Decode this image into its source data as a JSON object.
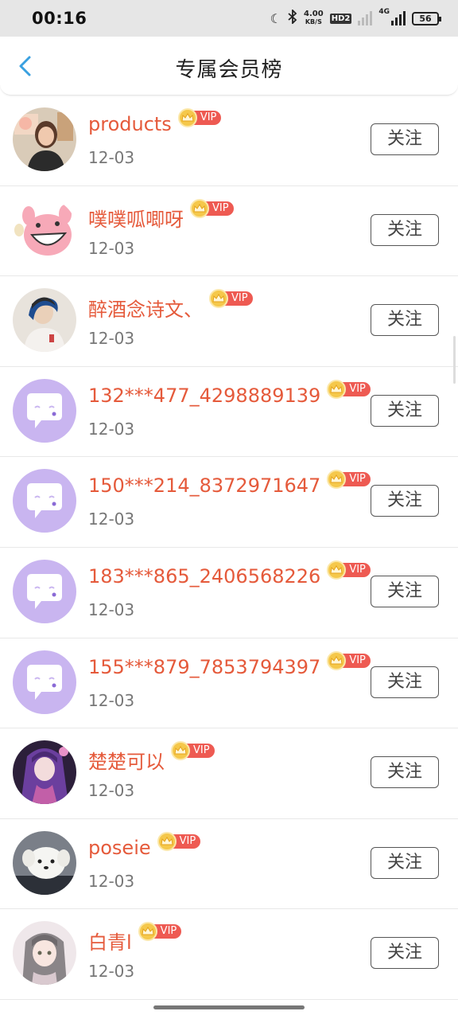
{
  "status_bar": {
    "time": "00:16",
    "speed_value": "4.00",
    "speed_unit": "KB/S",
    "hd_label": "HD2",
    "network": "4G",
    "battery": "56"
  },
  "header": {
    "title": "专属会员榜"
  },
  "members": [
    {
      "name": "products",
      "vip": "VIP",
      "date": "12-03",
      "follow": "关注",
      "avatar": "photo-girl"
    },
    {
      "name": "噗噗呱唧呀",
      "vip": "VIP",
      "date": "12-03",
      "follow": "关注",
      "avatar": "cartoon-pig"
    },
    {
      "name": "醉酒念诗文、",
      "vip": "VIP",
      "date": "12-03",
      "follow": "关注",
      "avatar": "photo-boy"
    },
    {
      "name": "132***477_4298889139",
      "vip": "VIP",
      "date": "12-03",
      "follow": "关注",
      "avatar": "default-chat"
    },
    {
      "name": "150***214_8372971647",
      "vip": "VIP",
      "date": "12-03",
      "follow": "关注",
      "avatar": "default-chat"
    },
    {
      "name": "183***865_2406568226",
      "vip": "VIP",
      "date": "12-03",
      "follow": "关注",
      "avatar": "default-chat"
    },
    {
      "name": "155***879_7853794397",
      "vip": "VIP",
      "date": "12-03",
      "follow": "关注",
      "avatar": "default-chat"
    },
    {
      "name": "楚楚可以",
      "vip": "VIP",
      "date": "12-03",
      "follow": "关注",
      "avatar": "anime-purple"
    },
    {
      "name": "poseie",
      "vip": "VIP",
      "date": "12-03",
      "follow": "关注",
      "avatar": "white-dog"
    },
    {
      "name": "白青l",
      "vip": "VIP",
      "date": "12-03",
      "follow": "关注",
      "avatar": "anime-girl"
    }
  ],
  "colors": {
    "name": "#e55a3b",
    "vip_tag": "#ee5a52",
    "crown": "#f5c84b",
    "default_avatar": "#c9b5f0",
    "back_arrow": "#3aa0e0"
  }
}
